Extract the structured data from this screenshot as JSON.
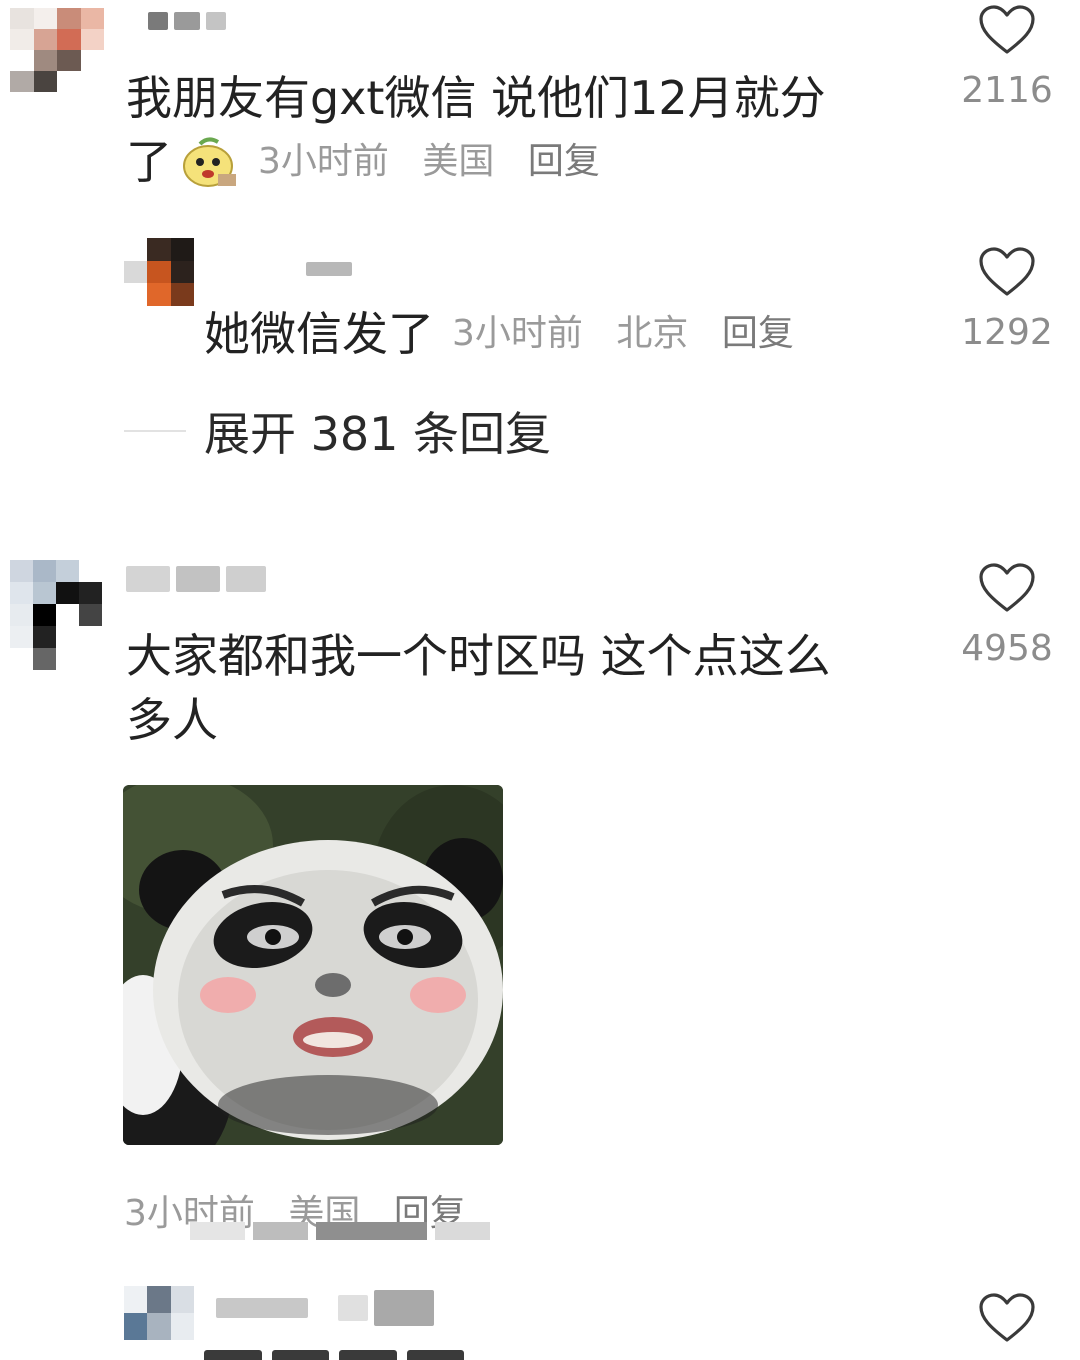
{
  "comments": [
    {
      "username": "",
      "text": "我朋友有gxt微信 说他们12月就分了",
      "text_line1": "我朋友有gxt微信 说他们12月就分",
      "text_line2": "了",
      "time": "3小时前",
      "location": "美国",
      "reply_label": "回复",
      "likes": "2116",
      "emoji": "banana-face-emoji"
    },
    {
      "username": "",
      "text": "她微信发了",
      "time": "3小时前",
      "location": "北京",
      "reply_label": "回复",
      "likes": "1292"
    },
    {
      "username": "",
      "text": "大家都和我一个时区吗 这个点这么多人",
      "text_line1": "大家都和我一个时区吗 这个点这么",
      "text_line2": "多人",
      "time": "3小时前",
      "location": "美国",
      "reply_label": "回复",
      "likes": "4958",
      "image": "panda-meme-sticker"
    }
  ],
  "expand_replies": {
    "label": "展开 381 条回复"
  },
  "icons": {
    "like": "heart-outline-icon"
  },
  "colors": {
    "text": "#222222",
    "meta": "#9a9a9a",
    "likes": "#8c8c8c",
    "background": "#ffffff"
  }
}
